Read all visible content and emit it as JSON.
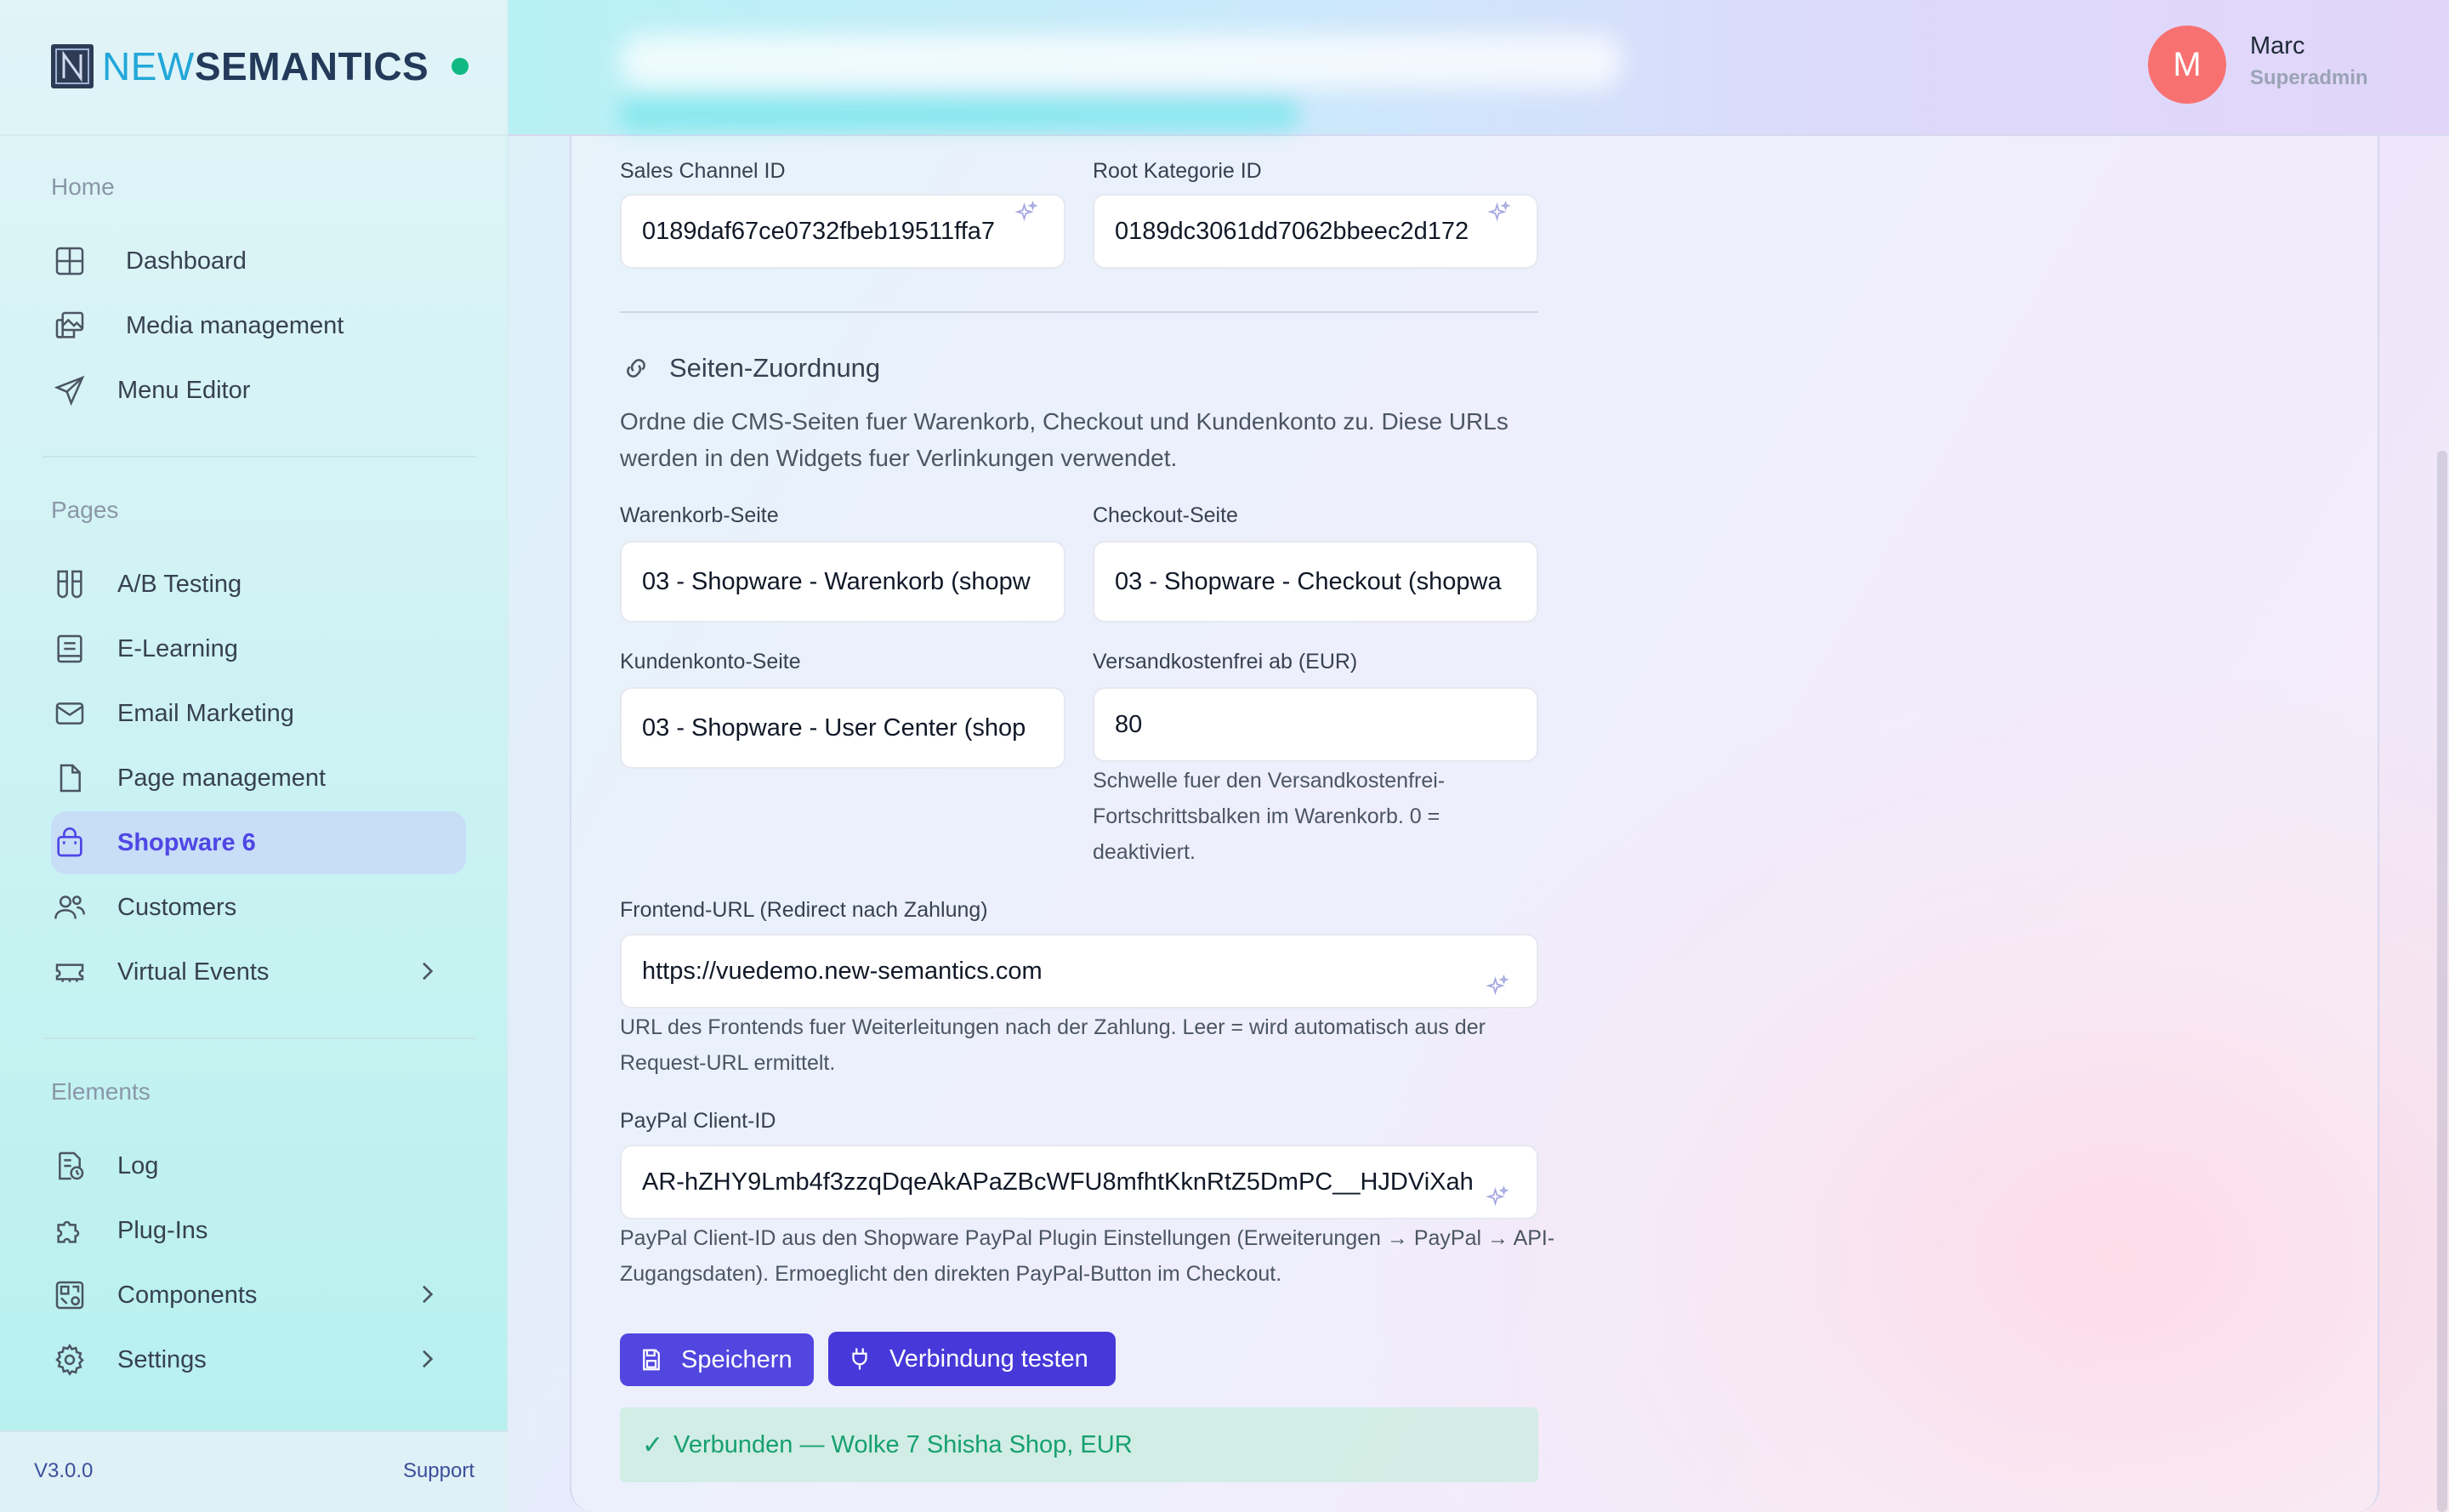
{
  "brand": {
    "prefix": "NEW",
    "suffix": "SEMANTICS",
    "status_color": "#10b981"
  },
  "sidebar": {
    "sections": [
      {
        "title": "Home"
      },
      {
        "title": "Pages"
      },
      {
        "title": "Elements"
      }
    ],
    "home_items": [
      {
        "label": "Dashboard",
        "icon": "grid-icon"
      },
      {
        "label": "Media management",
        "icon": "images-icon"
      },
      {
        "label": "Menu Editor",
        "icon": "send-icon"
      }
    ],
    "pages_items": [
      {
        "label": "A/B Testing",
        "icon": "test-tubes-icon"
      },
      {
        "label": "E-Learning",
        "icon": "book-icon"
      },
      {
        "label": "Email Marketing",
        "icon": "mail-icon"
      },
      {
        "label": "Page management",
        "icon": "file-icon"
      },
      {
        "label": "Shopware 6",
        "icon": "shopping-bag-icon",
        "active": true
      },
      {
        "label": "Customers",
        "icon": "users-icon"
      },
      {
        "label": "Virtual Events",
        "icon": "ticket-icon"
      }
    ],
    "elements_items": [
      {
        "label": "Log",
        "icon": "log-icon"
      },
      {
        "label": "Plug-Ins",
        "icon": "puzzle-icon"
      },
      {
        "label": "Components",
        "icon": "components-icon"
      },
      {
        "label": "Settings",
        "icon": "gear-icon"
      }
    ],
    "footer": {
      "version": "V3.0.0",
      "support": "Support"
    }
  },
  "user": {
    "initial": "M",
    "name": "Marc",
    "role": "Superadmin",
    "avatar_color": "#f87171"
  },
  "form": {
    "sales_channel": {
      "label": "Sales Channel ID",
      "value": "0189daf67ce0732fbeb19511ffa7"
    },
    "root_category": {
      "label": "Root Kategorie ID",
      "value": "0189dc3061dd7062bbeec2d172"
    },
    "section_title": "Seiten-Zuordnung",
    "section_desc": "Ordne die CMS-Seiten fuer Warenkorb, Checkout und Kundenkonto zu. Diese URLs werden in den Widgets fuer Verlinkungen verwendet.",
    "cart_page": {
      "label": "Warenkorb-Seite",
      "value": "03 - Shopware - Warenkorb (shopw"
    },
    "checkout_page": {
      "label": "Checkout-Seite",
      "value": "03 - Shopware - Checkout (shopwa"
    },
    "account_page": {
      "label": "Kundenkonto-Seite",
      "value": "03 - Shopware - User Center (shop"
    },
    "free_shipping": {
      "label": "Versandkostenfrei ab (EUR)",
      "value": "80",
      "help": "Schwelle fuer den Versandkostenfrei-Fortschrittsbalken im Warenkorb. 0 = deaktiviert."
    },
    "frontend_url": {
      "label": "Frontend-URL (Redirect nach Zahlung)",
      "value": "https://vuedemo.new-semantics.com",
      "help": "URL des Frontends fuer Weiterleitungen nach der Zahlung. Leer = wird automatisch aus der Request-URL ermittelt."
    },
    "paypal": {
      "label": "PayPal Client-ID",
      "value": "AR-hZHY9Lmb4f3zzqDqeAkAPaZBcWFU8mfhtKknRtZ5DmPC__HJDViXah",
      "help": "PayPal Client-ID aus den Shopware PayPal Plugin Einstellungen (Erweiterungen → PayPal → API-Zugangsdaten). Ermoeglicht den direkten PayPal-Button im Checkout."
    },
    "save_label": "Speichern",
    "test_label": "Verbindung testen",
    "success_message": "Verbunden — Wolke 7 Shisha Shop, EUR",
    "accent_color": "#5146e0",
    "success_color": "#16a070"
  }
}
